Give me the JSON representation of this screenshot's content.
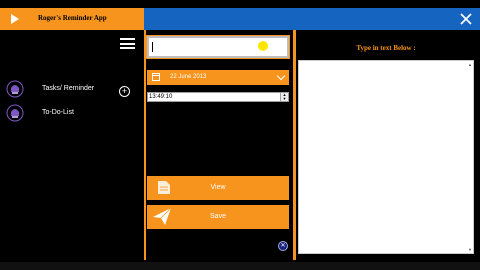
{
  "app": {
    "title": "Roger's Reminder App"
  },
  "sidebar": {
    "items": [
      {
        "label": "Tasks/ Reminder"
      },
      {
        "label": "To-Do-List"
      }
    ],
    "add_symbol": "+"
  },
  "form": {
    "search": {
      "value": "",
      "placeholder": ""
    },
    "date_value": "22 June 2013",
    "time_value": "13:49:10",
    "time_spin_up": "▲",
    "time_spin_down": "▼",
    "view_label": "View",
    "save_label": "Save",
    "cancel_symbol": "✕"
  },
  "notes": {
    "heading": "Type in text Below :",
    "value": ""
  },
  "colors": {
    "accent": "#f7941d",
    "titlebar_blue": "#1565c0",
    "background": "#000000"
  },
  "icons": [
    "play-icon",
    "close-icon",
    "menu-icon",
    "bell-icon",
    "add-icon",
    "calendar-icon",
    "chevron-down-icon",
    "document-icon",
    "send-icon",
    "cancel-icon"
  ]
}
